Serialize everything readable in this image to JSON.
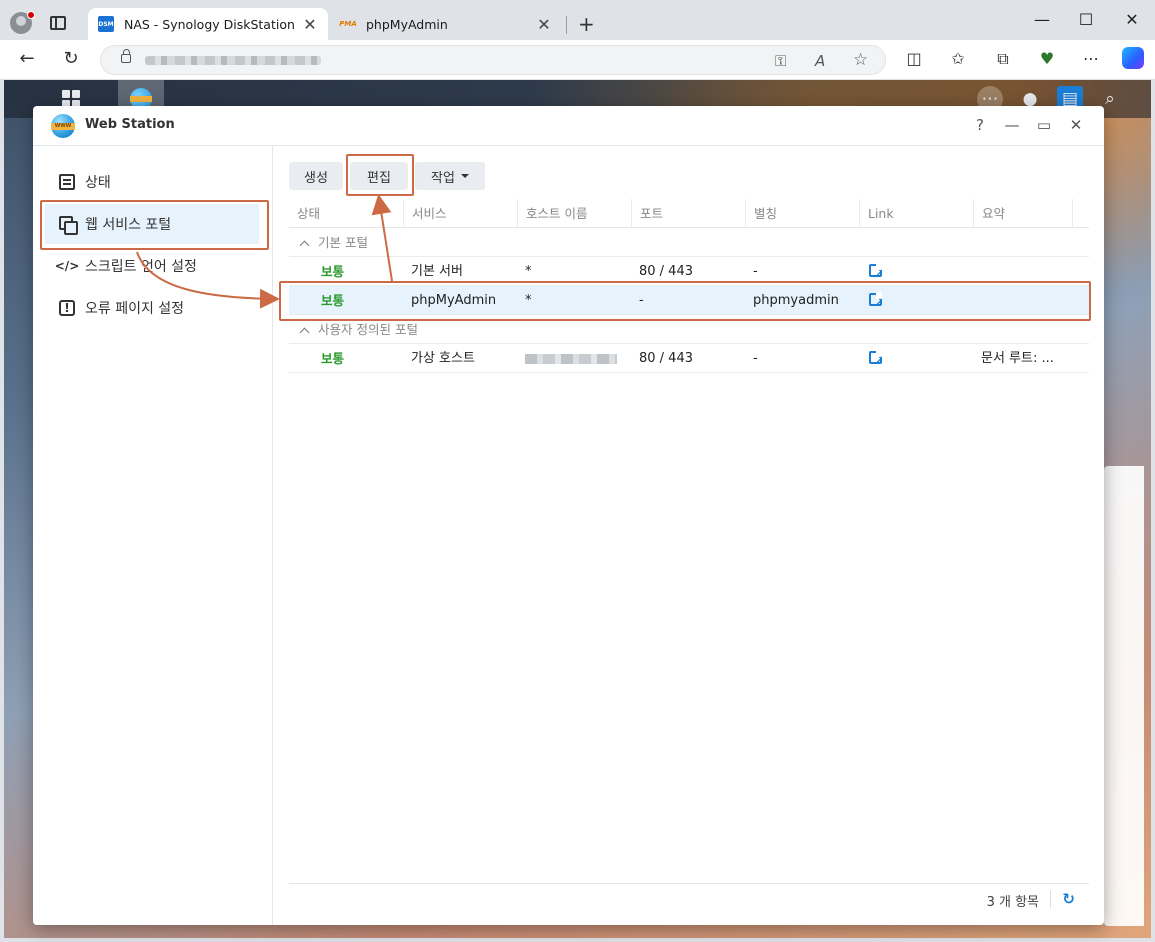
{
  "browser": {
    "tabs": [
      {
        "label": "NAS - Synology DiskStation",
        "favicon": "DSM",
        "active": true
      },
      {
        "label": "phpMyAdmin",
        "favicon": "PMA",
        "active": false
      }
    ],
    "icons": {
      "back": "←",
      "reload": "↻",
      "key": "⚿",
      "read_aloud": "A",
      "favorite": "☆",
      "split": "◫",
      "favorites": "✩",
      "collections": "⧉",
      "health": "♥",
      "more": "⋯",
      "minimize": "—",
      "maximize": "☐",
      "close": "✕",
      "new_tab": "+"
    }
  },
  "window": {
    "title": "Web Station",
    "controls": {
      "help": "?",
      "minimize": "—",
      "maximize": "▭",
      "close": "✕"
    }
  },
  "sidebar": {
    "items": [
      {
        "label": "상태",
        "icon": "status-icon"
      },
      {
        "label": "웹 서비스 포털",
        "icon": "portal-icon",
        "selected": true
      },
      {
        "label": "스크립트 언어 설정",
        "icon": "code-icon"
      },
      {
        "label": "오류 페이지 설정",
        "icon": "error-icon"
      }
    ]
  },
  "toolbar": {
    "create_label": "생성",
    "edit_label": "편집",
    "action_label": "작업"
  },
  "grid": {
    "columns": [
      "상태",
      "서비스",
      "호스트 이름",
      "포트",
      "별칭",
      "Link",
      "요약"
    ],
    "groups": [
      {
        "label": "기본 포털",
        "rows": [
          {
            "status": "보통",
            "service": "기본 서버",
            "host": "*",
            "port": "80 / 443",
            "alias": "-",
            "summary": ""
          },
          {
            "status": "보통",
            "service": "phpMyAdmin",
            "host": "*",
            "port": "-",
            "alias": "phpmyadmin",
            "summary": "",
            "selected": true
          }
        ]
      },
      {
        "label": "사용자 정의된 포털",
        "rows": [
          {
            "status": "보통",
            "service": "가상 호스트",
            "host": "",
            "port": "80 / 443",
            "alias": "-",
            "summary": "문서 루트: ..."
          }
        ]
      }
    ]
  },
  "footer": {
    "count": "3 개 항목"
  },
  "colors": {
    "accent": "#1a7dd6",
    "status_ok": "#2a9a2a",
    "annotation": "#cc6a45",
    "selected_bg": "#e6f2fc"
  }
}
